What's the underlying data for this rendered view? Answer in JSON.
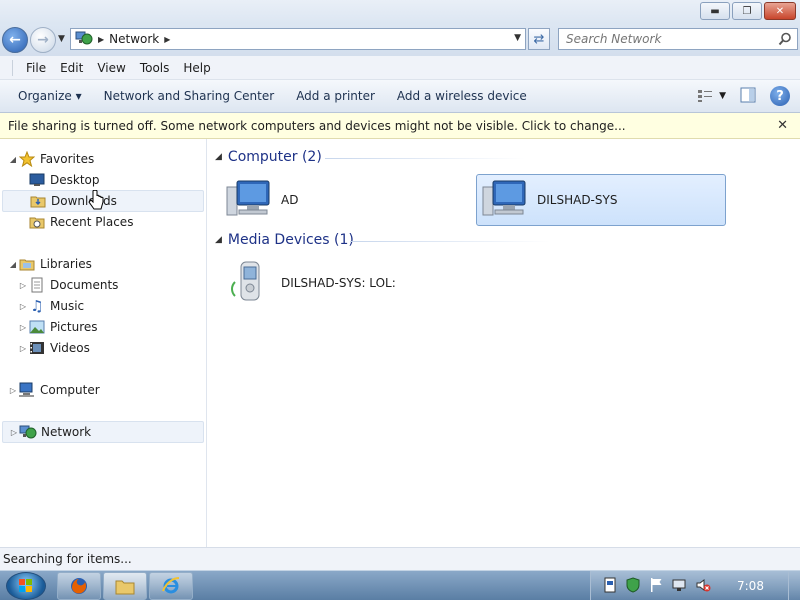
{
  "window": {
    "minimize": "▬",
    "maximize": "❐",
    "close": "✕"
  },
  "address": {
    "crumb": "Network",
    "search_placeholder": "Search Network"
  },
  "menu": [
    "File",
    "Edit",
    "View",
    "Tools",
    "Help"
  ],
  "commands": {
    "organize": "Organize ▾",
    "network_sharing": "Network and Sharing Center",
    "add_printer": "Add a printer",
    "add_wireless": "Add a wireless device"
  },
  "infobar": {
    "message": "File sharing is turned off. Some network computers and devices might not be visible. Click to change..."
  },
  "nav": {
    "favorites": "Favorites",
    "desktop": "Desktop",
    "downloads": "Downloads",
    "recent_places": "Recent Places",
    "libraries": "Libraries",
    "documents": "Documents",
    "music": "Music",
    "pictures": "Pictures",
    "videos": "Videos",
    "computer": "Computer",
    "network": "Network"
  },
  "content": {
    "computer_group": "Computer (2)",
    "computers": [
      "AD",
      "DILSHAD-SYS"
    ],
    "media_group": "Media Devices (1)",
    "media": [
      "DILSHAD-SYS: LOL:"
    ]
  },
  "status": "Searching for items...",
  "taskbar": {
    "clock": "7:08"
  }
}
